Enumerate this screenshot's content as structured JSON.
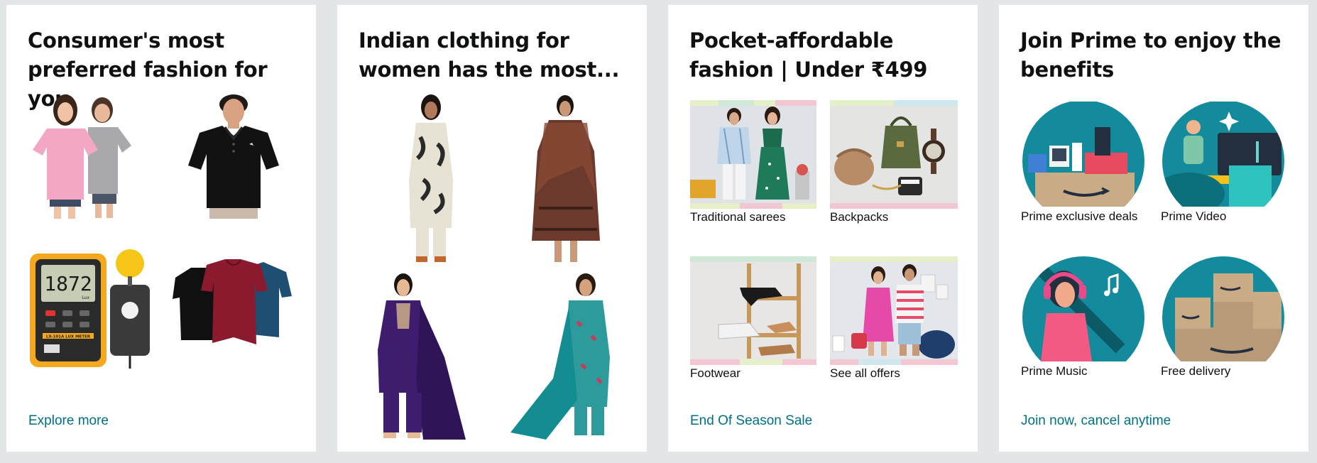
{
  "cards": [
    {
      "title": "Consumer's most preferred fashion for you",
      "link": "Explore more",
      "items": [
        {
          "alt": "Women's pink and grey oversized t-shirts"
        },
        {
          "alt": "Men's black polo t-shirt"
        },
        {
          "alt": "Digital lux meter",
          "meter_reading": "1872",
          "meter_unit": "Lux",
          "meter_brand": "LX-101A LUX METER"
        },
        {
          "alt": "Women's tops in black, maroon and blue"
        }
      ]
    },
    {
      "title": "Indian clothing for women has the most...",
      "items": [
        {
          "alt": "Cream printed kurta set"
        },
        {
          "alt": "Brown printed anarkali with dupatta"
        },
        {
          "alt": "Purple embroidered kurta set"
        },
        {
          "alt": "Teal floral kurta with dupatta"
        }
      ]
    },
    {
      "title": "Pocket-affordable fashion | Under ₹499",
      "link": "End Of Season Sale",
      "items": [
        {
          "label": "Traditional sarees"
        },
        {
          "label": "Backpacks"
        },
        {
          "label": "Footwear"
        },
        {
          "label": "See all offers"
        }
      ]
    },
    {
      "title": "Join Prime to enjoy the benefits",
      "link": "Join now, cancel anytime",
      "items": [
        {
          "label": "Prime exclusive deals"
        },
        {
          "label": "Prime Video"
        },
        {
          "label": "Prime Music"
        },
        {
          "label": "Free delivery"
        }
      ]
    }
  ],
  "colors": {
    "page_bg": "#e3e6e6",
    "card_bg": "#ffffff",
    "link": "#007185",
    "text": "#0f1111",
    "prime_teal": "#148b9c"
  }
}
